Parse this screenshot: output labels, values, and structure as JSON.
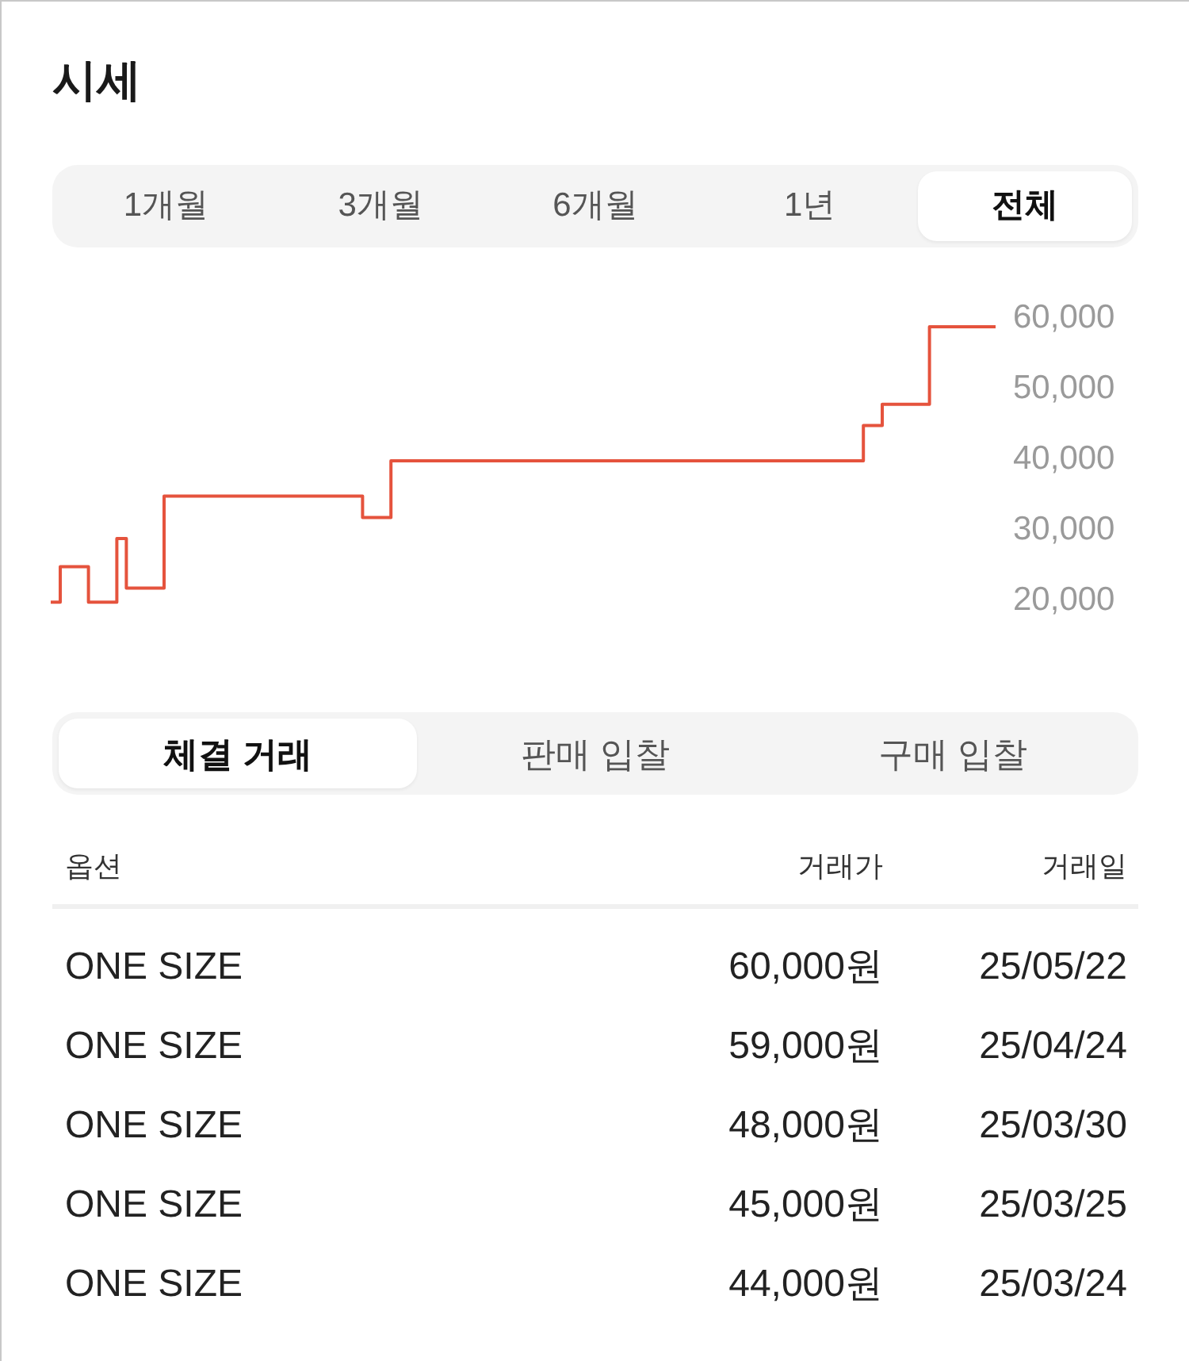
{
  "title": "시세",
  "period_tabs": [
    {
      "label": "1개월",
      "selected": false
    },
    {
      "label": "3개월",
      "selected": false
    },
    {
      "label": "6개월",
      "selected": false
    },
    {
      "label": "1년",
      "selected": false
    },
    {
      "label": "전체",
      "selected": true
    }
  ],
  "chart": {
    "chart_data": {
      "type": "line",
      "categories": [
        null,
        null,
        null,
        null,
        null,
        null,
        null,
        null,
        null,
        null,
        null,
        null,
        null,
        null,
        null,
        null,
        null,
        null,
        null,
        null,
        null,
        null,
        null,
        null,
        null,
        null,
        null,
        null,
        null,
        null,
        null,
        null,
        null,
        null,
        null,
        null,
        null,
        null,
        null,
        null,
        null,
        null,
        null,
        null,
        null,
        null,
        null,
        null,
        null,
        null,
        null,
        null,
        null,
        null,
        null,
        null,
        null,
        null,
        null,
        null,
        null,
        null,
        null,
        null,
        null,
        null,
        null,
        null,
        null,
        null,
        null,
        null,
        null,
        null,
        null,
        null,
        null,
        null,
        null,
        null,
        null,
        null,
        null,
        null,
        null,
        null,
        null,
        null,
        null,
        null,
        null,
        null,
        null,
        null,
        null,
        null,
        null,
        null,
        null,
        null,
        null
      ],
      "ylim": [
        20000,
        60000
      ],
      "yticks": [
        {
          "value": 60000,
          "label": "60,000"
        },
        {
          "value": 50000,
          "label": "50,000"
        },
        {
          "value": 40000,
          "label": "40,000"
        },
        {
          "value": 30000,
          "label": "30,000"
        },
        {
          "value": 20000,
          "label": "20,000"
        }
      ],
      "series": [
        {
          "color": "#e5533d",
          "values": [
            20000,
            25000,
            25000,
            25000,
            20000,
            20000,
            20000,
            29000,
            22000,
            22000,
            22000,
            22000,
            35000,
            35000,
            35000,
            35000,
            35000,
            35000,
            35000,
            35000,
            35000,
            35000,
            35000,
            35000,
            35000,
            35000,
            35000,
            35000,
            35000,
            35000,
            35000,
            35000,
            35000,
            32000,
            32000,
            32000,
            40000,
            40000,
            40000,
            40000,
            40000,
            40000,
            40000,
            40000,
            40000,
            40000,
            40000,
            40000,
            40000,
            40000,
            40000,
            40000,
            40000,
            40000,
            40000,
            40000,
            40000,
            40000,
            40000,
            40000,
            40000,
            40000,
            40000,
            40000,
            40000,
            40000,
            40000,
            40000,
            40000,
            40000,
            40000,
            40000,
            40000,
            40000,
            40000,
            40000,
            40000,
            40000,
            40000,
            40000,
            40000,
            40000,
            40000,
            40000,
            40000,
            40000,
            45000,
            45000,
            48000,
            48000,
            48000,
            48000,
            48000,
            59000,
            59000,
            59000,
            59000,
            59000,
            59000,
            59000,
            59000
          ]
        }
      ]
    }
  },
  "trade_tabs": [
    {
      "label": "체결 거래",
      "selected": true
    },
    {
      "label": "판매 입찰",
      "selected": false
    },
    {
      "label": "구매 입찰",
      "selected": false
    }
  ],
  "table": {
    "columns": [
      "옵션",
      "거래가",
      "거래일"
    ],
    "rows": [
      [
        "ONE SIZE",
        "60,000원",
        "25/05/22"
      ],
      [
        "ONE SIZE",
        "59,000원",
        "25/04/24"
      ],
      [
        "ONE SIZE",
        "48,000원",
        "25/03/30"
      ],
      [
        "ONE SIZE",
        "45,000원",
        "25/03/25"
      ],
      [
        "ONE SIZE",
        "44,000원",
        "25/03/24"
      ]
    ]
  }
}
